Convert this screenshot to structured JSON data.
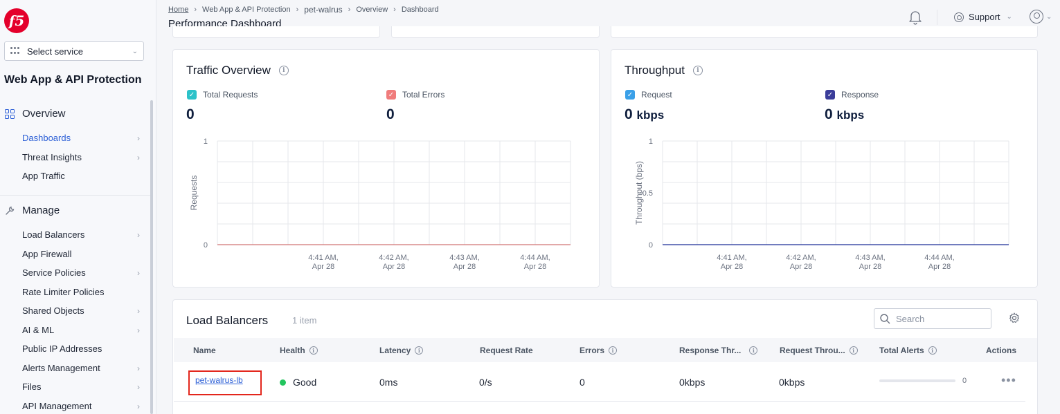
{
  "sidebar": {
    "logo": "f5",
    "select_service": "Select service",
    "workspace_title": "Web App & API Protection",
    "sections": [
      {
        "label": "Overview"
      },
      {
        "label": "Manage"
      }
    ],
    "overview_items": [
      {
        "label": "Dashboards",
        "active": true,
        "has_chevron": true
      },
      {
        "label": "Threat Insights",
        "has_chevron": true
      },
      {
        "label": "App Traffic",
        "has_chevron": false
      }
    ],
    "manage_items": [
      {
        "label": "Load Balancers",
        "has_chevron": true
      },
      {
        "label": "App Firewall",
        "has_chevron": false
      },
      {
        "label": "Service Policies",
        "has_chevron": true
      },
      {
        "label": "Rate Limiter Policies",
        "has_chevron": false
      },
      {
        "label": "Shared Objects",
        "has_chevron": true
      },
      {
        "label": "AI & ML",
        "has_chevron": true
      },
      {
        "label": "Public IP Addresses",
        "has_chevron": false
      },
      {
        "label": "Alerts Management",
        "has_chevron": true
      },
      {
        "label": "Files",
        "has_chevron": true
      },
      {
        "label": "API Management",
        "has_chevron": true
      }
    ]
  },
  "header": {
    "breadcrumb": [
      "Home",
      "Web App & API Protection",
      "pet-walrus",
      "Overview",
      "Dashboard"
    ],
    "title": "Performance Dashboard",
    "support_label": "Support"
  },
  "traffic": {
    "title": "Traffic Overview",
    "legend": [
      {
        "label": "Total Requests",
        "value": "0",
        "color": "#2cc2c9"
      },
      {
        "label": "Total Errors",
        "value": "0",
        "color": "#f07c7c"
      }
    ],
    "ylabel": "Requests",
    "yticks": [
      "1",
      "0"
    ],
    "xticks": [
      [
        "4:41 AM,",
        "Apr 28"
      ],
      [
        "4:42 AM,",
        "Apr 28"
      ],
      [
        "4:43 AM,",
        "Apr 28"
      ],
      [
        "4:44 AM,",
        "Apr 28"
      ]
    ]
  },
  "throughput": {
    "title": "Throughput",
    "legend": [
      {
        "label": "Request",
        "value": "0",
        "unit": "kbps",
        "color": "#3aa0e8"
      },
      {
        "label": "Response",
        "value": "0",
        "unit": "kbps",
        "color": "#3b3d9a"
      }
    ],
    "ylabel": "Throughput (bps)",
    "yticks": [
      "1",
      "0.5",
      "0"
    ],
    "xticks": [
      [
        "4:41 AM,",
        "Apr 28"
      ],
      [
        "4:42 AM,",
        "Apr 28"
      ],
      [
        "4:43 AM,",
        "Apr 28"
      ],
      [
        "4:44 AM,",
        "Apr 28"
      ]
    ]
  },
  "chart_data": [
    {
      "type": "line",
      "title": "Traffic Overview",
      "xlabel": "",
      "ylabel": "Requests",
      "x": [
        "4:41 AM, Apr 28",
        "4:42 AM, Apr 28",
        "4:43 AM, Apr 28",
        "4:44 AM, Apr 28"
      ],
      "series": [
        {
          "name": "Total Requests",
          "values": [
            0,
            0,
            0,
            0
          ]
        },
        {
          "name": "Total Errors",
          "values": [
            0,
            0,
            0,
            0
          ]
        }
      ],
      "ylim": [
        0,
        1
      ],
      "grid": true
    },
    {
      "type": "line",
      "title": "Throughput",
      "xlabel": "",
      "ylabel": "Throughput (bps)",
      "x": [
        "4:41 AM, Apr 28",
        "4:42 AM, Apr 28",
        "4:43 AM, Apr 28",
        "4:44 AM, Apr 28"
      ],
      "series": [
        {
          "name": "Request",
          "values": [
            0,
            0,
            0,
            0
          ]
        },
        {
          "name": "Response",
          "values": [
            0,
            0,
            0,
            0
          ]
        }
      ],
      "ylim": [
        0,
        1
      ],
      "grid": true
    }
  ],
  "load_balancers": {
    "title": "Load Balancers",
    "count": "1 item",
    "search_placeholder": "Search",
    "columns": [
      "Name",
      "Health",
      "Latency",
      "Request Rate",
      "Errors",
      "Response Thr...",
      "Request Throu...",
      "Total Alerts",
      "Actions"
    ],
    "rows": [
      {
        "name": "pet-walrus-lb",
        "health": "Good",
        "latency": "0ms",
        "request_rate": "0/s",
        "errors": "0",
        "response_throughput": "0kbps",
        "request_throughput": "0kbps",
        "total_alerts": "0",
        "actions": "•••"
      }
    ]
  }
}
